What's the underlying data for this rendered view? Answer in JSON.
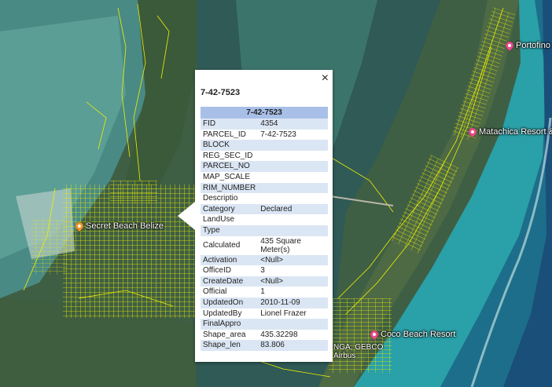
{
  "map": {
    "places": [
      {
        "name": "Portofino",
        "color": "#e84a8a"
      },
      {
        "name": "Matachica Resort &",
        "color": "#e84a8a"
      },
      {
        "name": "Secret Beach Belize",
        "color": "#f0922a"
      },
      {
        "name": "Coco Beach Resort",
        "color": "#e84a8a"
      }
    ],
    "attribution_line1": "NGA, GEBCO",
    "attribution_line2": "Airbus",
    "parcel_color": "#f0f000"
  },
  "popup": {
    "title": "7-42-7523",
    "table_header": "7-42-7523",
    "close_icon": "×",
    "rows": [
      {
        "key": "FID",
        "value": "4354"
      },
      {
        "key": "PARCEL_ID",
        "value": "7-42-7523"
      },
      {
        "key": "BLOCK",
        "value": ""
      },
      {
        "key": "REG_SEC_ID",
        "value": ""
      },
      {
        "key": "PARCEL_NO",
        "value": ""
      },
      {
        "key": "MAP_SCALE",
        "value": ""
      },
      {
        "key": "RIM_NUMBER",
        "value": ""
      },
      {
        "key": "Descriptio",
        "value": ""
      },
      {
        "key": "Category",
        "value": "Declared"
      },
      {
        "key": "LandUse",
        "value": ""
      },
      {
        "key": "Type",
        "value": ""
      },
      {
        "key": "Calculated",
        "value": "435 Square Meter(s)"
      },
      {
        "key": "Activation",
        "value": "<Null>"
      },
      {
        "key": "OfficeID",
        "value": "3"
      },
      {
        "key": "CreateDate",
        "value": "<Null>"
      },
      {
        "key": "Official",
        "value": "1"
      },
      {
        "key": "UpdatedOn",
        "value": "2010-11-09"
      },
      {
        "key": "UpdatedBy",
        "value": "Lionel Frazer"
      },
      {
        "key": "FinalAppro",
        "value": ""
      },
      {
        "key": "Shape_area",
        "value": "435.32298"
      },
      {
        "key": "Shape_len",
        "value": "83.806"
      }
    ]
  }
}
